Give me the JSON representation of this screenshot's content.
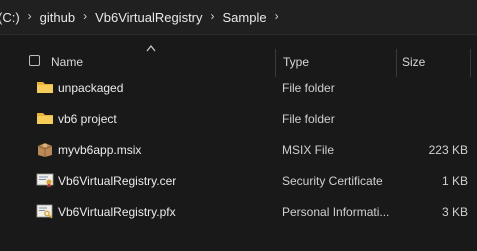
{
  "breadcrumb": {
    "items": [
      {
        "label": "(C:)"
      },
      {
        "label": "github"
      },
      {
        "label": "Vb6VirtualRegistry"
      },
      {
        "label": "Sample"
      }
    ],
    "separator": "›"
  },
  "columns": {
    "name": "Name",
    "type": "Type",
    "size": "Size"
  },
  "files": [
    {
      "name": "unpackaged",
      "type": "File folder",
      "size": "",
      "icon": "folder-icon"
    },
    {
      "name": "vb6 project",
      "type": "File folder",
      "size": "",
      "icon": "folder-icon"
    },
    {
      "name": "myvb6app.msix",
      "type": "MSIX File",
      "size": "223 KB",
      "icon": "package-icon"
    },
    {
      "name": "Vb6VirtualRegistry.cer",
      "type": "Security Certificate",
      "size": "1 KB",
      "icon": "certificate-icon"
    },
    {
      "name": "Vb6VirtualRegistry.pfx",
      "type": "Personal Informati...",
      "size": "3 KB",
      "icon": "pfx-certificate-icon"
    }
  ],
  "colors": {
    "background": "#191919",
    "folder": "#f3c44b"
  }
}
